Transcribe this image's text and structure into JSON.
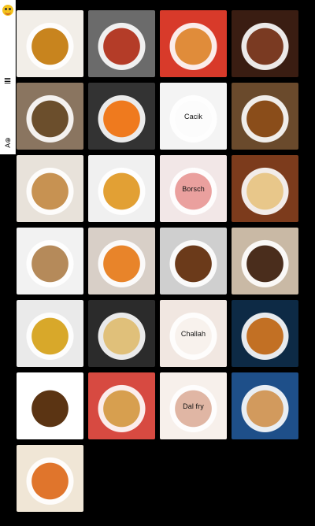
{
  "sidebar": {
    "logo_icon": "smiley-logo-icon",
    "menu_icon": "hamburger-menu-icon",
    "menu_glyph": "≣",
    "lang_label": "A⊕"
  },
  "tiles": [
    {
      "name": "flan",
      "label": "",
      "colors": [
        "#f2eee8",
        "#c8841e"
      ]
    },
    {
      "name": "lahmacun",
      "label": "",
      "colors": [
        "#6b6b6b",
        "#b43c28"
      ]
    },
    {
      "name": "rice-stew",
      "label": "",
      "colors": [
        "#d83a2a",
        "#e08c3a"
      ]
    },
    {
      "name": "grilled-meat",
      "label": "",
      "colors": [
        "#3a1d12",
        "#7a3a22"
      ]
    },
    {
      "name": "mushroom-stew",
      "label": "",
      "colors": [
        "#8a7560",
        "#6b4e2c"
      ]
    },
    {
      "name": "sushi",
      "label": "",
      "colors": [
        "#333",
        "#ef7a1e"
      ]
    },
    {
      "name": "cacik",
      "label": "Cacik",
      "colors": [
        "#ececec",
        "#fafafa"
      ]
    },
    {
      "name": "soup-bowl",
      "label": "",
      "colors": [
        "#6a4a2c",
        "#8a4d1a"
      ]
    },
    {
      "name": "borek",
      "label": "",
      "colors": [
        "#e8e2da",
        "#c79252"
      ]
    },
    {
      "name": "lentil-soup",
      "label": "",
      "colors": [
        "#f0f0f0",
        "#e2a034"
      ]
    },
    {
      "name": "borsch",
      "label": "Borsch",
      "colors": [
        "#e7d3d3",
        "#d9534f"
      ]
    },
    {
      "name": "hummus",
      "label": "",
      "colors": [
        "#7c3b1c",
        "#e8c78a"
      ]
    },
    {
      "name": "stuffed-potato",
      "label": "",
      "colors": [
        "#f2f2f2",
        "#b58a5a"
      ]
    },
    {
      "name": "kunefe",
      "label": "",
      "colors": [
        "#d8cfc7",
        "#e8842a"
      ]
    },
    {
      "name": "falafel",
      "label": "",
      "colors": [
        "#cfcfcf",
        "#6b3a1a"
      ]
    },
    {
      "name": "onion-rings",
      "label": "",
      "colors": [
        "#c9b9a5",
        "#4a2d1c"
      ]
    },
    {
      "name": "paella",
      "label": "",
      "colors": [
        "#eaeaea",
        "#d8a82a"
      ]
    },
    {
      "name": "cornbread",
      "label": "",
      "colors": [
        "#2b2b2b",
        "#e0c07a"
      ]
    },
    {
      "name": "challah",
      "label": "Challah",
      "colors": [
        "#e6d4c8",
        "#f3e7df"
      ]
    },
    {
      "name": "burger",
      "label": "",
      "colors": [
        "#0d2a45",
        "#c27024"
      ]
    },
    {
      "name": "falafel-pistachio",
      "label": "",
      "colors": [
        "#ffffff",
        "#5b3413"
      ]
    },
    {
      "name": "lasagna",
      "label": "",
      "colors": [
        "#d74a41",
        "#d79f4f"
      ]
    },
    {
      "name": "dal-fry",
      "label": "Dal fry",
      "colors": [
        "#f1e4db",
        "#c77a5a"
      ]
    },
    {
      "name": "chickpea-rice",
      "label": "",
      "colors": [
        "#1e4f89",
        "#d29a5d"
      ]
    },
    {
      "name": "roasted-veg",
      "label": "",
      "colors": [
        "#f0e6d6",
        "#e0752c"
      ]
    }
  ]
}
